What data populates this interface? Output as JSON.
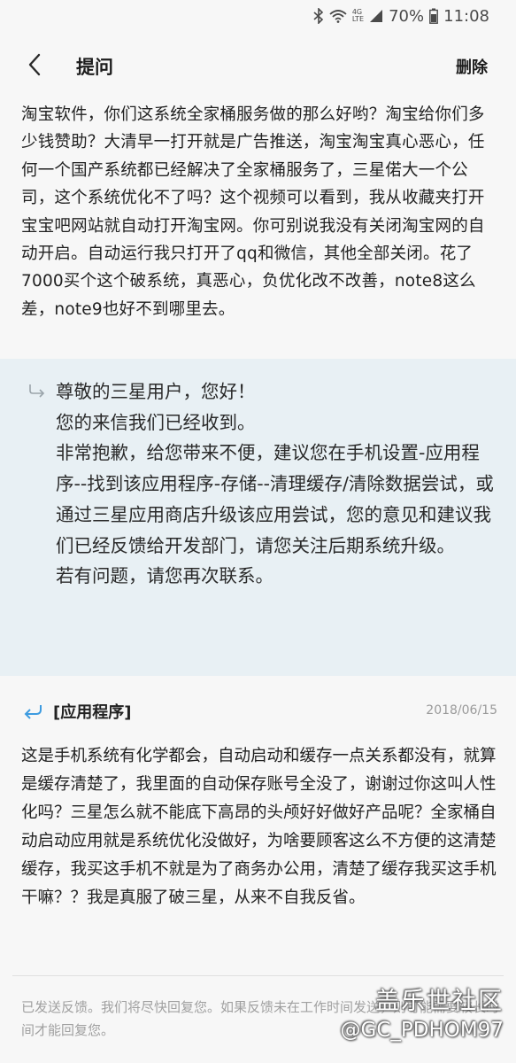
{
  "status_bar": {
    "network_top": "4G",
    "network_bottom": "LTE",
    "battery": "70%",
    "time": "11:08"
  },
  "header": {
    "title": "提问",
    "delete_label": "删除",
    "icons": [
      "back-arrow-icon",
      "bluetooth-icon",
      "wifi-icon",
      "signal-icon",
      "battery-icon"
    ]
  },
  "question": {
    "text": "淘宝软件，你们这系统全家桶服务做的那么好哟？淘宝给你们多少钱赞助？大清早一打开就是广告推送，淘宝淘宝真心恶心，任何一个国产系统都已经解决了全家桶服务了，三星偌大一个公司，这个系统优化不了吗？这个视频可以看到，我从收藏夹打开宝宝吧网站就自动打开淘宝网。你可别说我没有关闭淘宝网的自动开启。自动运行我只打开了qq和微信，其他全部关闭。花了7000买个这个破系统，真恶心，负优化改不改善，note8这么差，note9也好不到哪里去。"
  },
  "reply": {
    "text": "尊敬的三星用户，您好！\n您的来信我们已经收到。\n非常抱歉，给您带来不便，建议您在手机设置-应用程序--找到该应用程序-存储--清理缓存/清除数据尝试，或通过三星应用商店升级该应用尝试，您的意见和建议我们已经反馈给开发部门，请您关注后期系统升级。\n若有问题，请您再次联系。"
  },
  "followup": {
    "label": "[应用程序]",
    "date": "2018/06/15",
    "text": "这是手机系统有化学都会，自动启动和缓存一点关系都没有，就算是缓存清楚了，我里面的自动保存账号全没了，谢谢过你这叫人性化吗？三星怎么就不能底下高昂的头颅好好做好产品呢？全家桶自动启动应用就是系统优化没做好，为啥要顾客这么不方便的这清楚缓存，我买这手机不就是为了商务办公用，清楚了缓存我买这手机干嘛？？我是真服了破三星，从来不自我反省。"
  },
  "footer": {
    "note": "已发送反馈。我们将尽快回复您。如果反馈未在工作时间发送，则可能需要较长时间才能回复您。"
  },
  "watermark": {
    "site": "盖乐世社区",
    "user": "@GC_PDHOM97"
  },
  "colors": {
    "background": "#f7f7f7",
    "reply_background": "#e8f0f4",
    "accent_icon": "#3d9be0",
    "muted_text": "#a0a0a0"
  }
}
